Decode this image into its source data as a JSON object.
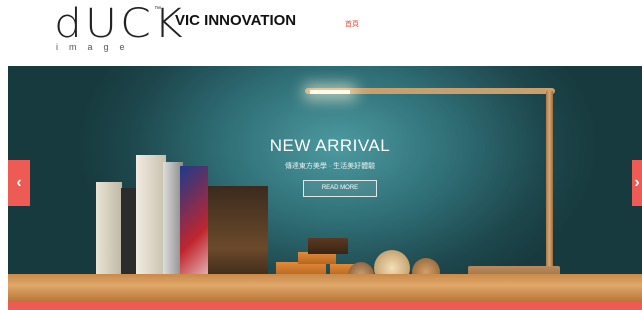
{
  "header": {
    "logo": {
      "word": "dUCK",
      "tm": "™",
      "sub": "image"
    },
    "brand": "VIC INNOVATION",
    "nav_link": "首頁"
  },
  "slider": {
    "title": "NEW ARRIVAL",
    "subtitle": "傳達東方美學 · 生活美好體驗",
    "button": "READ MORE",
    "prev_arrow": "‹",
    "next_arrow": "›"
  },
  "colors": {
    "accent": "#ee5a54",
    "slide_bg": "#2f6e75",
    "shelf": "#e0a86a"
  }
}
